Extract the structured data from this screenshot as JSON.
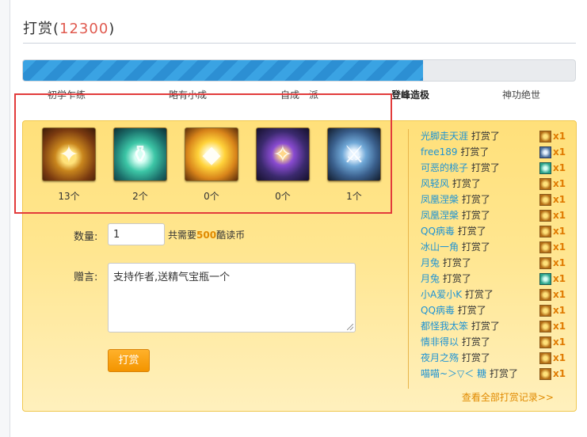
{
  "header": {
    "title": "打赏",
    "count": "12300"
  },
  "progress": {
    "fraction": 0.725
  },
  "levels": [
    "初学乍练",
    "略有小成",
    "自成一派",
    "登峰造极",
    "神功绝世"
  ],
  "current_level_index": 3,
  "gifts": [
    {
      "icon": "shield-icon",
      "count": "13个"
    },
    {
      "icon": "bottle-icon",
      "count": "2个"
    },
    {
      "icon": "gem-icon",
      "count": "0个"
    },
    {
      "icon": "book-icon",
      "count": "0个"
    },
    {
      "icon": "sword-icon",
      "count": "1个"
    }
  ],
  "form": {
    "qty_label": "数量:",
    "qty_value": "1",
    "cost_prefix": "共需要",
    "cost_amount": "500",
    "cost_suffix": "酷读币",
    "msg_label": "赠言:",
    "msg_value": "支持作者,送精气宝瓶一个",
    "submit_label": "打赏"
  },
  "records": [
    {
      "user": "光脚走天涯",
      "action": "打赏了",
      "icon": "shield",
      "qty": "x1"
    },
    {
      "user": "free189",
      "action": "打赏了",
      "icon": "sword",
      "qty": "x1"
    },
    {
      "user": "可恶的桃子",
      "action": "打赏了",
      "icon": "bottle",
      "qty": "x1"
    },
    {
      "user": "风轻风",
      "action": "打赏了",
      "icon": "shield",
      "qty": "x1"
    },
    {
      "user": "凤凰涅槃",
      "action": "打赏了",
      "icon": "shield",
      "qty": "x1"
    },
    {
      "user": "凤凰涅槃",
      "action": "打赏了",
      "icon": "shield",
      "qty": "x1"
    },
    {
      "user": "QQ病毒",
      "action": "打赏了",
      "icon": "shield",
      "qty": "x1"
    },
    {
      "user": "冰山一角",
      "action": "打赏了",
      "icon": "shield",
      "qty": "x1"
    },
    {
      "user": "月兔",
      "action": "打赏了",
      "icon": "shield",
      "qty": "x1"
    },
    {
      "user": "月兔",
      "action": "打赏了",
      "icon": "bottle",
      "qty": "x1"
    },
    {
      "user": "小A爱小K",
      "action": "打赏了",
      "icon": "shield",
      "qty": "x1"
    },
    {
      "user": "QQ病毒",
      "action": "打赏了",
      "icon": "shield",
      "qty": "x1"
    },
    {
      "user": "都怪我太笨",
      "action": "打赏了",
      "icon": "shield",
      "qty": "x1"
    },
    {
      "user": "情非得以",
      "action": "打赏了",
      "icon": "shield",
      "qty": "x1"
    },
    {
      "user": "夜月之殇",
      "action": "打赏了",
      "icon": "shield",
      "qty": "x1"
    },
    {
      "user": "喵喵~＞▽＜ 糖",
      "action": "打赏了",
      "icon": "shield",
      "qty": "x1"
    }
  ],
  "view_all": "查看全部打赏记录>>"
}
